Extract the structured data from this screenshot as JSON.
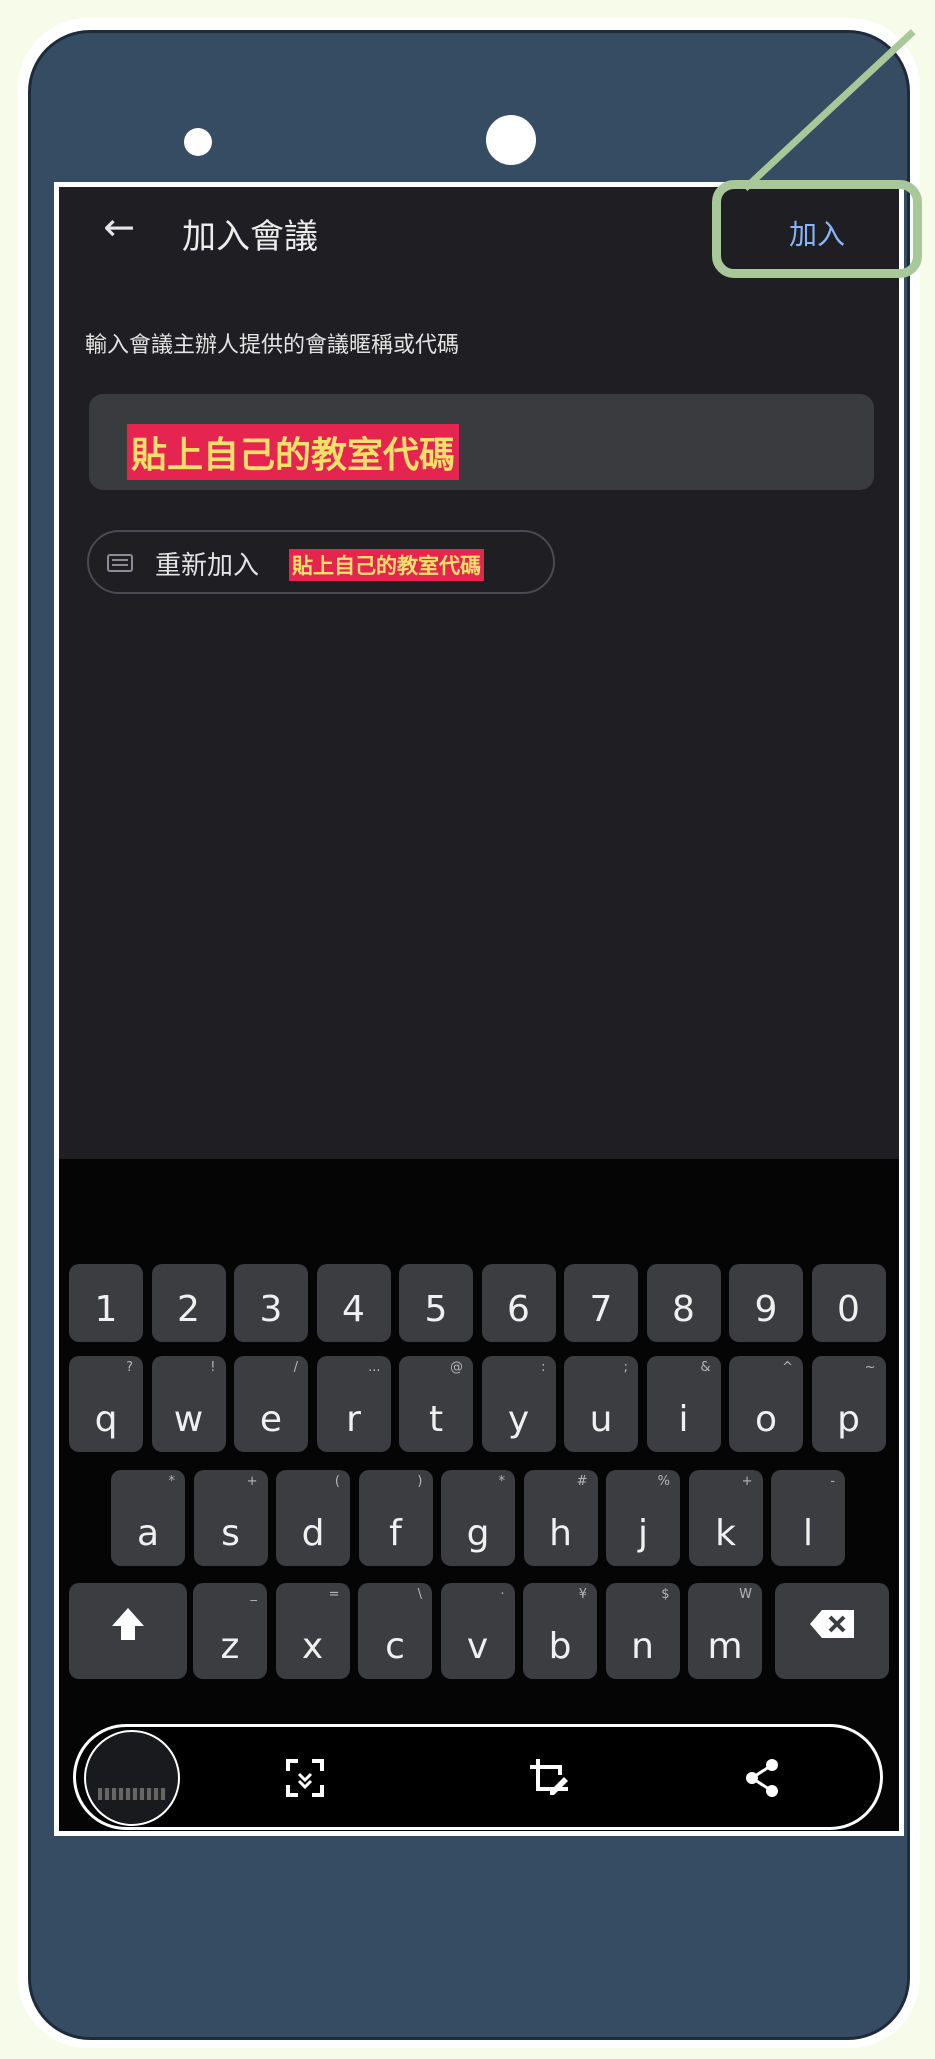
{
  "header": {
    "back_icon": "arrow-left-icon",
    "title": "加入會議",
    "join_label": "加入"
  },
  "form": {
    "instruction": "輸入會議主辦人提供的會議暱稱或代碼",
    "code_value": "貼上自己的教室代碼"
  },
  "rejoin": {
    "icon": "keyboard-icon",
    "label": "重新加入",
    "code": "貼上自己的教室代碼"
  },
  "keyboard": {
    "number_row": [
      "1",
      "2",
      "3",
      "4",
      "5",
      "6",
      "7",
      "8",
      "9",
      "0"
    ],
    "row1": [
      {
        "key": "q",
        "hint": "?"
      },
      {
        "key": "w",
        "hint": "!"
      },
      {
        "key": "e",
        "hint": "/"
      },
      {
        "key": "r",
        "hint": "..."
      },
      {
        "key": "t",
        "hint": "@"
      },
      {
        "key": "y",
        "hint": ":"
      },
      {
        "key": "u",
        "hint": ";"
      },
      {
        "key": "i",
        "hint": "&"
      },
      {
        "key": "o",
        "hint": "^"
      },
      {
        "key": "p",
        "hint": "~"
      }
    ],
    "row2": [
      {
        "key": "a",
        "hint": "*"
      },
      {
        "key": "s",
        "hint": "+"
      },
      {
        "key": "d",
        "hint": "("
      },
      {
        "key": "f",
        "hint": ")"
      },
      {
        "key": "g",
        "hint": "*"
      },
      {
        "key": "h",
        "hint": "#"
      },
      {
        "key": "j",
        "hint": "%"
      },
      {
        "key": "k",
        "hint": "+"
      },
      {
        "key": "l",
        "hint": "-"
      }
    ],
    "row3": [
      {
        "key": "z",
        "hint": "_"
      },
      {
        "key": "x",
        "hint": "="
      },
      {
        "key": "c",
        "hint": "\\"
      },
      {
        "key": "v",
        "hint": "·"
      },
      {
        "key": "b",
        "hint": "¥"
      },
      {
        "key": "n",
        "hint": "$"
      },
      {
        "key": "m",
        "hint": "W"
      }
    ],
    "shift_icon": "shift-arrow-icon",
    "backspace_icon": "backspace-icon"
  },
  "toolbar": {
    "scan_icon": "scan-icon",
    "edit_icon": "crop-edit-icon",
    "share_icon": "share-icon"
  },
  "colors": {
    "screen_bg": "#1f1f23",
    "accent_blue": "#8ab4f8",
    "highlight_bg": "#e5244f",
    "highlight_text": "#f1e06a",
    "frame_green": "#a9c89a",
    "phone_body": "#364c62"
  }
}
